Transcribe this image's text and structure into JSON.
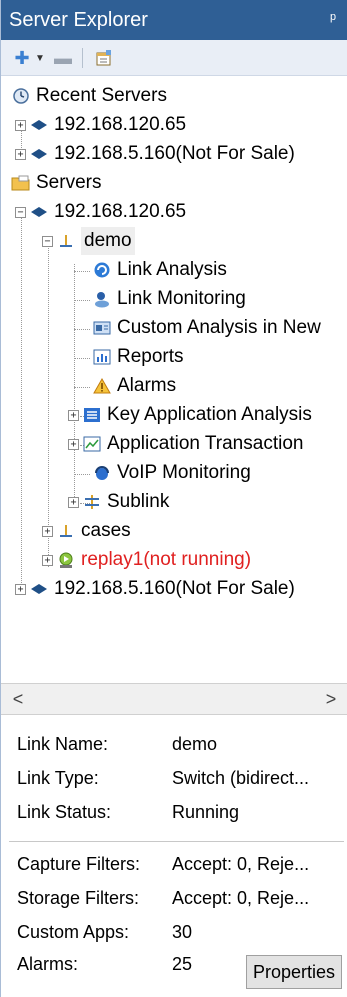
{
  "panel": {
    "title": "Server Explorer",
    "pin_glyph": "ᵖ"
  },
  "toolbar": {
    "add_icon": "plus-icon",
    "dropdown_icon": "chevron-down-icon",
    "remove_icon": "minus-icon",
    "properties_icon": "properties-icon"
  },
  "tree": {
    "recent_servers": "Recent Servers",
    "recent_1": "192.168.120.65",
    "recent_2": "192.168.5.160(Not For Sale)",
    "servers": "Servers",
    "server_1": "192.168.120.65",
    "demo": "demo",
    "link_analysis": "Link Analysis",
    "link_monitoring": "Link Monitoring",
    "custom_analysis": "Custom Analysis in New",
    "reports": "Reports",
    "alarms": "Alarms",
    "key_app": "Key Application Analysis",
    "app_transaction": "Application Transaction",
    "voip": "VoIP Monitoring",
    "sublink": "Sublink",
    "cases": "cases",
    "replay": "replay1(not running)",
    "server_2": "192.168.5.160(Not For Sale)"
  },
  "info": {
    "link_name_label": "Link Name:",
    "link_name_value": "demo",
    "link_type_label": "Link Type:",
    "link_type_value": "Switch (bidirect...",
    "link_status_label": "Link Status:",
    "link_status_value": "Running",
    "capture_label": "Capture Filters:",
    "capture_value": "Accept: 0, Reje...",
    "storage_label": "Storage Filters:",
    "storage_value": "Accept: 0, Reje...",
    "custom_apps_label": "Custom Apps:",
    "custom_apps_value": "30",
    "alarms_label": "Alarms:",
    "alarms_value": "25",
    "properties_button": "Properties"
  },
  "colors": {
    "title_bar": "#2f5f95",
    "not_running": "#e02020"
  }
}
